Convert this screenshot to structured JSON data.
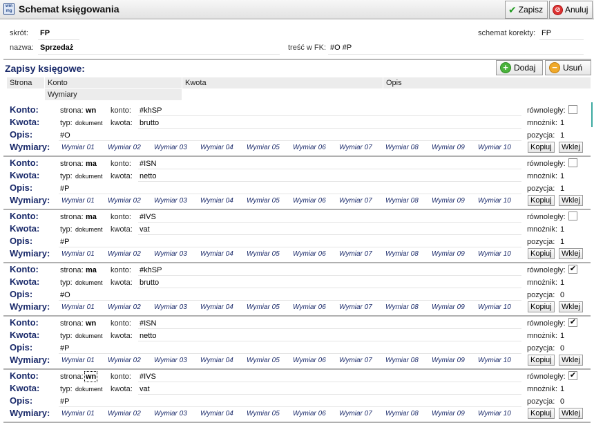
{
  "window": {
    "title": "Schemat księgowania",
    "icon": "window-icon",
    "icon_text": "wm\nmg"
  },
  "toolbar": {
    "save_label": "Zapisz",
    "cancel_label": "Anuluj"
  },
  "header": {
    "skrot_label": "skrót:",
    "skrot_value": "FP",
    "nazwa_label": "nazwa:",
    "nazwa_value": "Sprzedaż",
    "tresc_label": "treść w FK:",
    "tresc_value": "#O #P",
    "korekta_label": "schemat korekty:",
    "korekta_value": "FP"
  },
  "section": {
    "title": "Zapisy księgowe:",
    "add_label": "Dodaj",
    "remove_label": "Usuń"
  },
  "columns": {
    "strona": "Strona",
    "konto": "Konto",
    "kwota": "Kwota",
    "opis": "Opis",
    "wymiary": "Wymiary"
  },
  "labels": {
    "konto": "Konto:",
    "kwota": "Kwota:",
    "opis": "Opis:",
    "wymiary": "Wymiary:",
    "strona": "strona:",
    "konto_small": "konto:",
    "typ": "typ:",
    "kwota_small": "kwota:",
    "rownolegly": "równoległy:",
    "mnoznik": "mnożnik:",
    "pozycja": "pozycja:",
    "kopiuj": "Kopiuj",
    "wklej": "Wklej"
  },
  "dimensions": [
    "Wymiar 01",
    "Wymiar 02",
    "Wymiar 03",
    "Wymiar 04",
    "Wymiar 05",
    "Wymiar 06",
    "Wymiar 07",
    "Wymiar 08",
    "Wymiar 09",
    "Wymiar 10"
  ],
  "records": [
    {
      "strona": "wn",
      "konto": "#khSP",
      "typ": "dokument",
      "kwota": "brutto",
      "opis": "#O",
      "rownolegly": false,
      "mnoznik": "1",
      "pozycja": "1"
    },
    {
      "strona": "ma",
      "konto": "#ISN",
      "typ": "dokument",
      "kwota": "netto",
      "opis": "#P",
      "rownolegly": false,
      "mnoznik": "1",
      "pozycja": "1"
    },
    {
      "strona": "ma",
      "konto": "#IVS",
      "typ": "dokument",
      "kwota": "vat",
      "opis": "#P",
      "rownolegly": false,
      "mnoznik": "1",
      "pozycja": "1"
    },
    {
      "strona": "ma",
      "konto": "#khSP",
      "typ": "dokument",
      "kwota": "brutto",
      "opis": "#O",
      "rownolegly": true,
      "mnoznik": "1",
      "pozycja": "0"
    },
    {
      "strona": "wn",
      "konto": "#ISN",
      "typ": "dokument",
      "kwota": "netto",
      "opis": "#P",
      "rownolegly": true,
      "mnoznik": "1",
      "pozycja": "0"
    },
    {
      "strona": "wn",
      "konto": "#IVS",
      "typ": "dokument",
      "kwota": "vat",
      "opis": "#P",
      "rownolegly": true,
      "mnoznik": "1",
      "pozycja": "0"
    }
  ]
}
